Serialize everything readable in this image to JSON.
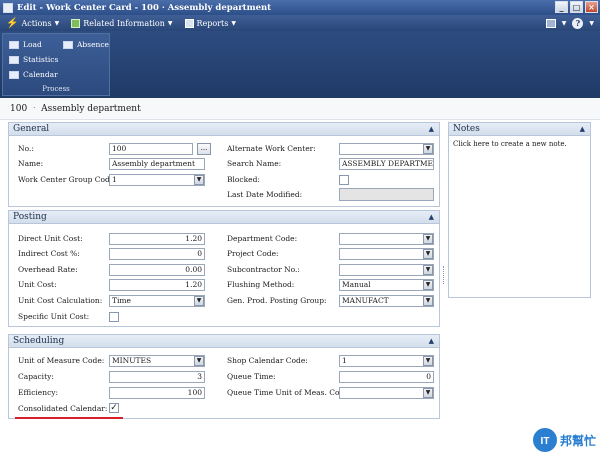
{
  "window": {
    "title": "Edit - Work Center Card - 100 · Assembly department",
    "buttons": [
      "_",
      "□",
      "×"
    ]
  },
  "commandbar": {
    "actions": "Actions",
    "related": "Related Information",
    "reports": "Reports",
    "help": "?"
  },
  "ribbon": {
    "load": "Load",
    "absence": "Absence",
    "statistics": "Statistics",
    "calendar": "Calendar",
    "group": "Process"
  },
  "page": {
    "no": "100",
    "sep": "·",
    "name": "Assembly department"
  },
  "general": {
    "header": "General",
    "no_label": "No.:",
    "no_value": "100",
    "assist": "...",
    "name_label": "Name:",
    "name_value": "Assembly department",
    "group_label": "Work Center Group Code:",
    "group_value": "1",
    "alt_label": "Alternate Work Center:",
    "alt_value": "",
    "search_label": "Search Name:",
    "search_value": "ASSEMBLY DEPARTMENT",
    "blocked_label": "Blocked:",
    "lastmod_label": "Last Date Modified:",
    "lastmod_value": ""
  },
  "posting": {
    "header": "Posting",
    "direct_label": "Direct Unit Cost:",
    "direct_value": "1.20",
    "indirect_label": "Indirect Cost %:",
    "indirect_value": "0",
    "overhead_label": "Overhead Rate:",
    "overhead_value": "0.00",
    "unitcost_label": "Unit Cost:",
    "unitcost_value": "1.20",
    "calc_label": "Unit Cost Calculation:",
    "calc_value": "Time",
    "specific_label": "Specific Unit Cost:",
    "dept_label": "Department Code:",
    "dept_value": "",
    "project_label": "Project Code:",
    "project_value": "",
    "subcon_label": "Subcontractor No.:",
    "subcon_value": "",
    "flush_label": "Flushing Method:",
    "flush_value": "Manual",
    "gen_label": "Gen. Prod. Posting Group:",
    "gen_value": "MANUFACT"
  },
  "scheduling": {
    "header": "Scheduling",
    "uom_label": "Unit of Measure Code:",
    "uom_value": "MINUTES",
    "capacity_label": "Capacity:",
    "capacity_value": "3",
    "efficiency_label": "Efficiency:",
    "efficiency_value": "100",
    "consol_label": "Consolidated Calendar:",
    "consol_check": "✓",
    "shop_label": "Shop Calendar Code:",
    "shop_value": "1",
    "queue_label": "Queue Time:",
    "queue_value": "0",
    "queueuom_label": "Queue Time Unit of Meas. Code:",
    "queueuom_value": ""
  },
  "notes": {
    "header": "Notes",
    "text": "Click here to create a new note."
  },
  "colors": {
    "title_bar": "#2c4f8a",
    "ribbon": "#203a66",
    "fasttab_header": "#d3deec",
    "highlight_line": "#d8202a"
  },
  "icons": [
    "app-icon",
    "lightning-icon",
    "related-info-icon",
    "reports-icon",
    "load-icon",
    "absence-icon",
    "statistics-icon",
    "calendar-icon",
    "view-icon",
    "help-icon",
    "chevron-up-icon",
    "dropdown-arrow-icon"
  ],
  "watermark": {
    "text": "IT邦幫忙"
  }
}
